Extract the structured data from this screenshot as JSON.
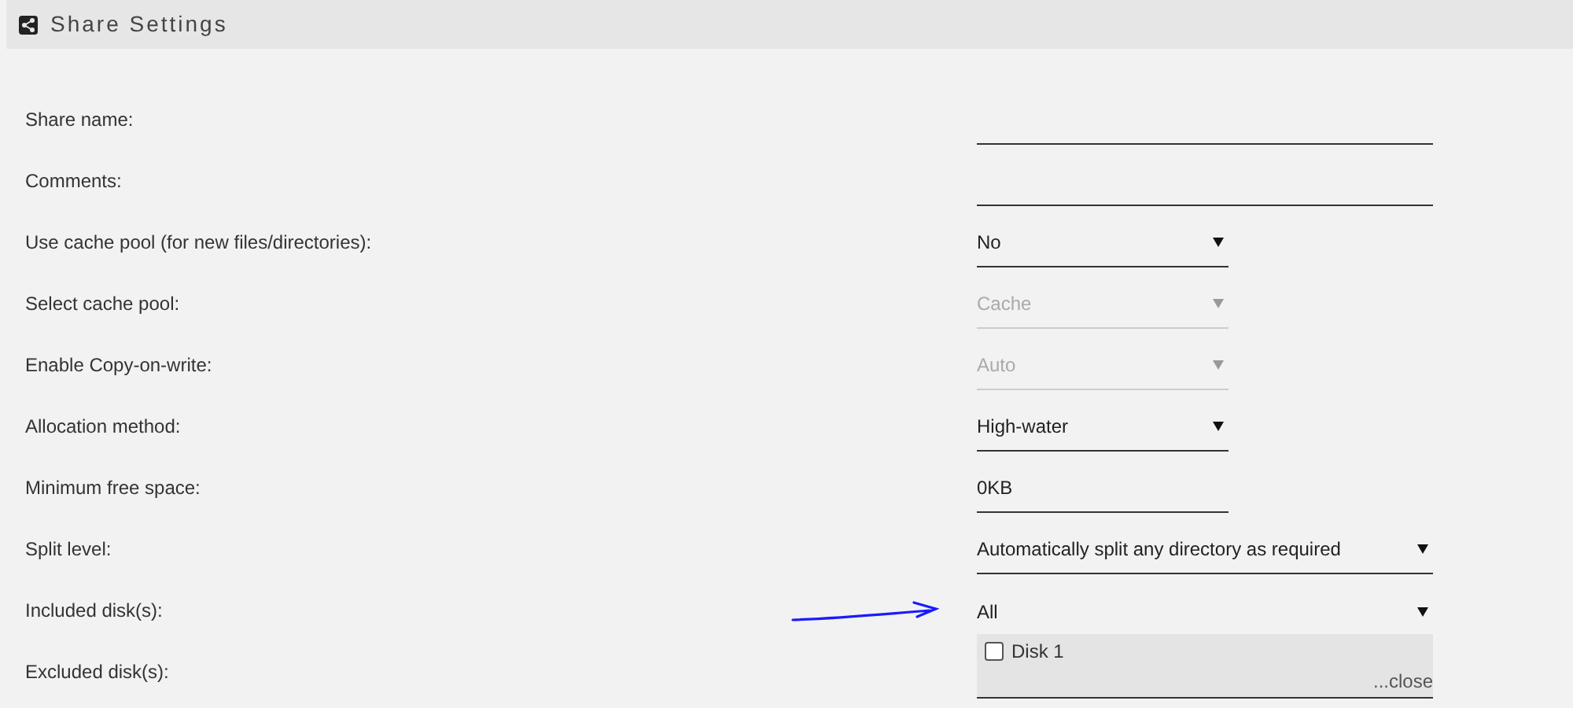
{
  "header": {
    "title": "Share Settings"
  },
  "rows": [
    {
      "label": "Share name:",
      "kind": "text",
      "value": ""
    },
    {
      "label": "Comments:",
      "kind": "text",
      "value": ""
    },
    {
      "label": "Use cache pool (for new files/directories):",
      "kind": "select",
      "value": "No",
      "disabled": false
    },
    {
      "label": "Select cache pool:",
      "kind": "select",
      "value": "Cache",
      "disabled": true
    },
    {
      "label": "Enable Copy-on-write:",
      "kind": "select",
      "value": "Auto",
      "disabled": true
    },
    {
      "label": "Allocation method:",
      "kind": "select",
      "value": "High-water",
      "disabled": false
    },
    {
      "label": "Minimum free space:",
      "kind": "short-text",
      "value": "0KB"
    },
    {
      "label": "Split level:",
      "kind": "wide-select",
      "value": "Automatically split any directory as required",
      "disabled": false
    },
    {
      "label": "Included disk(s):",
      "kind": "multiselect",
      "value": "All",
      "options": [
        {
          "label": "Disk 1",
          "checked": false
        }
      ],
      "close": "...close"
    },
    {
      "label": "Excluded disk(s):",
      "kind": "none"
    }
  ]
}
